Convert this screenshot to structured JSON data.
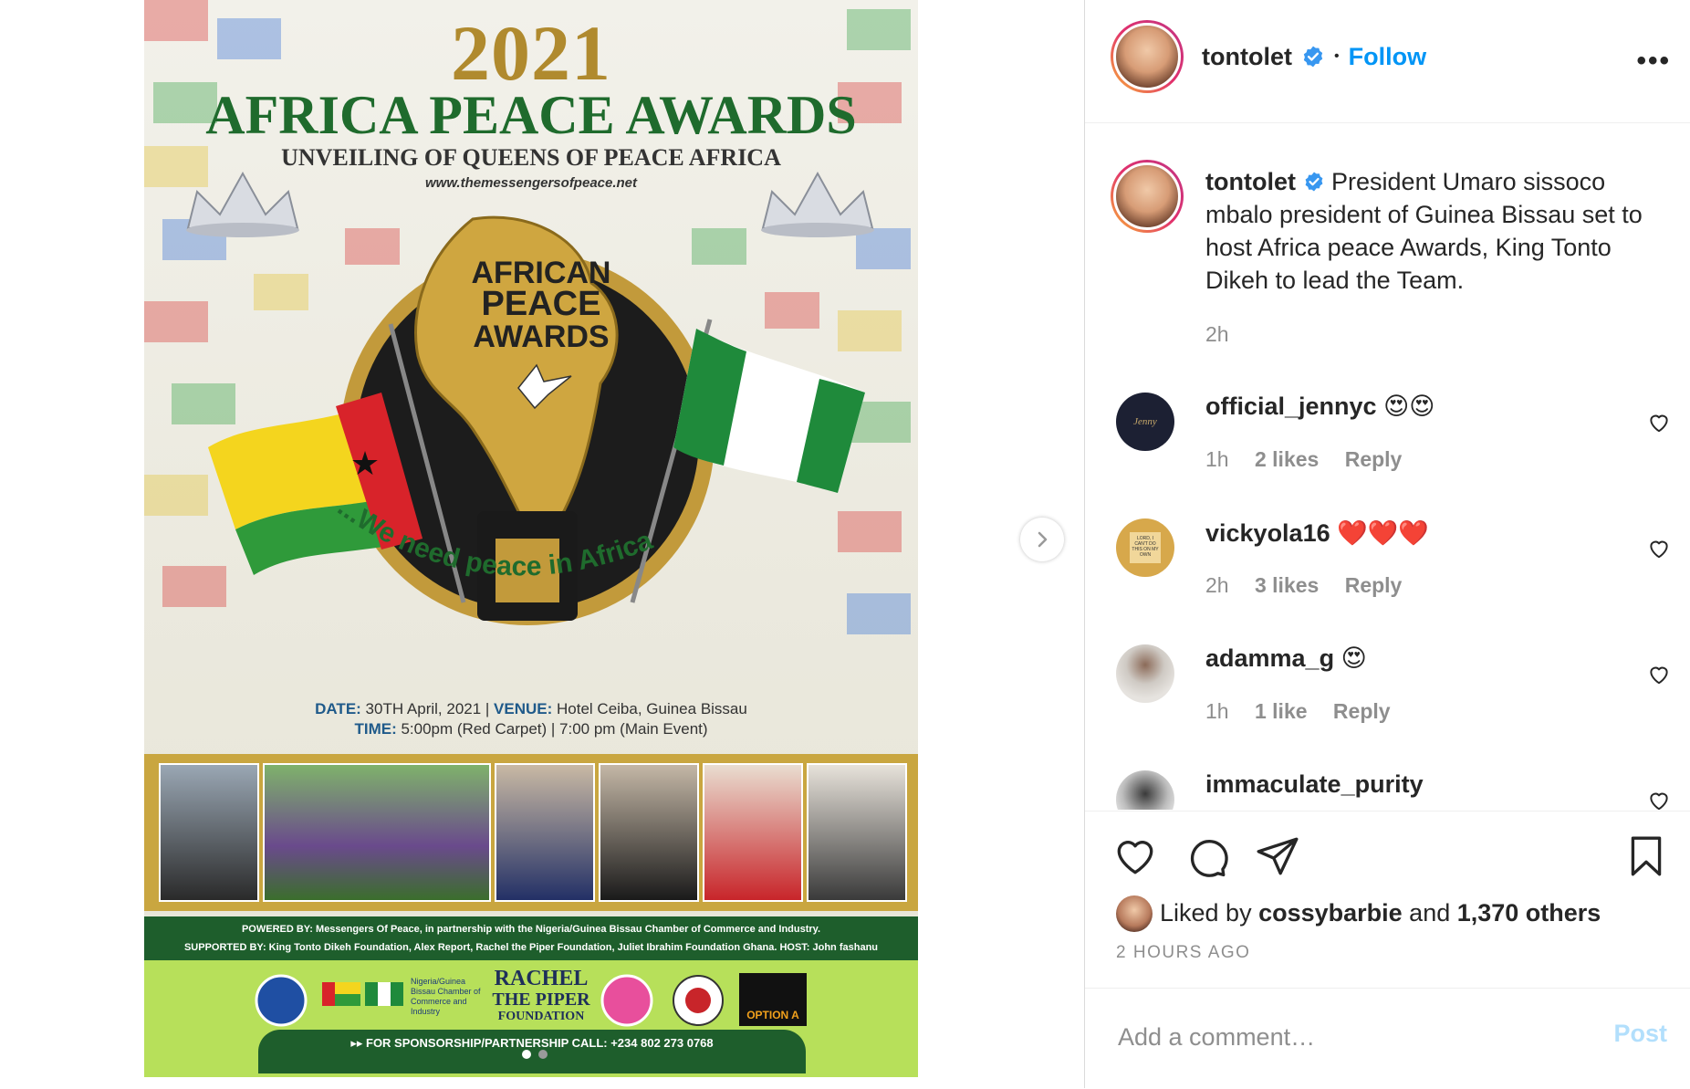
{
  "poster": {
    "year": "2021",
    "title": "AFRICA PEACE AWARDS",
    "subtitle": "UNVEILING OF QUEENS OF PEACE AFRICA",
    "url": "www.themessengersofpeace.net",
    "emblem_line1": "AFRICAN",
    "emblem_line2": "PEACE",
    "emblem_line3": "AWARDS",
    "slogan": "...We need peace in Africa",
    "date_label": "DATE:",
    "date_value": " 30TH April, 2021  |  ",
    "venue_label": "VENUE:",
    "venue_value": " Hotel Ceiba, Guinea Bissau",
    "time_label": "TIME:",
    "time_value": " 5:00pm (Red Carpet) | 7:00 pm (Main Event)",
    "powered_by": "POWERED BY: Messengers Of Peace, in partnership with the Nigeria/Guinea Bissau Chamber of Commerce and Industry.",
    "supported_by": "SUPPORTED BY: King Tonto Dikeh Foundation, Alex Report, Rachel the Piper Foundation, Juliet Ibrahim Foundation Ghana. HOST: John fashanu",
    "chamber_text": "Nigeria/Guinea Bissau Chamber of Commerce and Industry",
    "rachel_logo_1": "RACHEL",
    "rachel_logo_2": "THE PIPER",
    "rachel_logo_3": "FOUNDATION",
    "option_logo": "OPTION A",
    "sponsorship": "▸▸ FOR SPONSORSHIP/PARTNERSHIP CALL: +234 802 273 0768"
  },
  "carousel": {
    "current_index": 1,
    "total": 2
  },
  "header": {
    "username": "tontolet",
    "separator": "•",
    "follow_label": "Follow",
    "more_label": "•••"
  },
  "caption": {
    "username": "tontolet",
    "text": "President Umaro sissoco mbalo president of Guinea Bissau set to host Africa peace Awards, King Tonto Dikeh to lead the Team.",
    "time": "2h"
  },
  "comments": [
    {
      "username": "official_jennyc",
      "text": "😍😍",
      "time": "1h",
      "likes": "2 likes",
      "reply": "Reply",
      "avatar_text": "Jenny"
    },
    {
      "username": "vickyola16",
      "text": "❤️❤️❤️",
      "time": "2h",
      "likes": "3 likes",
      "reply": "Reply",
      "avatar_text": "LORD, I CAN'T DO THIS ON MY OWN"
    },
    {
      "username": "adamma_g",
      "text": "😍",
      "time": "1h",
      "likes": "1 like",
      "reply": "Reply"
    },
    {
      "username": "immaculate_purity",
      "text": "",
      "time": "",
      "likes": "",
      "reply": ""
    }
  ],
  "likes": {
    "prefix": "Liked by ",
    "user": "cossybarbie",
    "middle": " and ",
    "others": "1,370 others"
  },
  "timestamp": "2 HOURS AGO",
  "add_comment": {
    "placeholder": "Add a comment…",
    "post_label": "Post"
  },
  "colors": {
    "accent": "#0095f6",
    "post_disabled": "#b2dffc",
    "poster_green": "#1e5e2c",
    "poster_gold": "#b08a2e",
    "poster_lime": "#b7e05a"
  },
  "icons": [
    "heart-icon",
    "comment-icon",
    "share-icon",
    "bookmark-icon",
    "verified-badge-icon",
    "chevron-right-icon",
    "more-options-icon"
  ]
}
